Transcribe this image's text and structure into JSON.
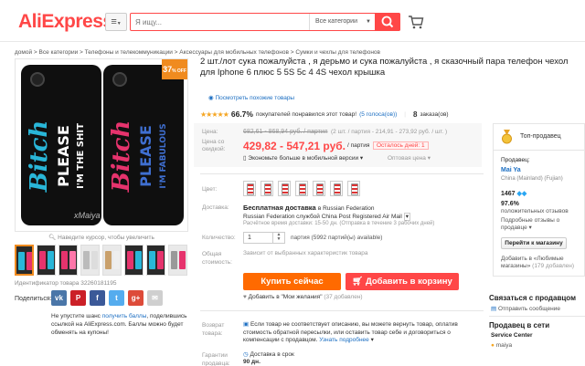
{
  "header": {
    "logo": "AliExpress",
    "search_placeholder": "Я ищу...",
    "category": "Все категории"
  },
  "breadcrumb": "домой > Все категории > Телефоны и телекоммуникации > Аксессуары для мобильных телефонов > Сумки и чехлы для телефонов",
  "gallery": {
    "discount": "37",
    "discount_suffix": "% OFF",
    "zoom_hint": "Наведите курсор, чтобы увеличить",
    "watermark": "xMaiya",
    "item_id": "Идентификатор товара 32260181195"
  },
  "share": {
    "label": "Поделиться:",
    "icons": [
      {
        "name": "vk-icon",
        "glyph": "vk",
        "color": "#4a76a8"
      },
      {
        "name": "pinterest-icon",
        "glyph": "P",
        "color": "#cb2027"
      },
      {
        "name": "facebook-icon",
        "glyph": "f",
        "color": "#3b5998"
      },
      {
        "name": "twitter-icon",
        "glyph": "t",
        "color": "#55acee"
      },
      {
        "name": "google-plus-icon",
        "glyph": "g+",
        "color": "#dd4b39"
      },
      {
        "name": "email-icon",
        "glyph": "✉",
        "color": "#cfcfcf"
      }
    ],
    "note_pre": "Не упустите шанс ",
    "note_link": "получить баллы",
    "note_post": ", поделившись ссылкой на AliExpress.com. Баллы можно будет обменять на купоны!"
  },
  "product": {
    "title": "2 шт./лот сука пожалуйста , я дерьмо и сука пожалуйста , я сказочный пара телефон чехол для Iphone 6 плюс 5 5S 5c 4 4S чехол крышка",
    "similar": "Посмотреть похожие товары",
    "stars": "★★★★★",
    "rating_pct": "66.7%",
    "rating_text": "покупателей понравился этот товар!",
    "votes": "(5 голоса(ов))",
    "orders": "8",
    "orders_label": "заказа(ов)"
  },
  "price": {
    "label": "Цена:",
    "old": "682,61 - 868,94 руб. / партия",
    "old_alt": "(2 шт. / партия - 214,91 - 273,92 руб. / шт. )",
    "discount_label": "Цена со скидкой:",
    "new": "429,82 - 547,21 руб.",
    "unit": "/ партия",
    "countdown": "Осталось дней: 1",
    "mobile": "Экономьте больше в мобильной версии",
    "wholesale": "Оптовая цена"
  },
  "options": {
    "color_label": "Цвет:",
    "delivery_label": "Доставка:",
    "delivery_free": "Бесплатная доставка",
    "delivery_to": "в Russian Federation",
    "delivery_method": "Russian Federation службой China Post Registered Air Mail",
    "delivery_time": "Расчётное время доставки: 15-50 дн. (Отправка в течение 3 рабочих дней)",
    "qty_label": "Количество:",
    "qty_value": "1",
    "qty_text": "партия (5992 партий(ы) available)",
    "total_label": "Общая стоимость:",
    "total_text": "Зависит от выбранных характеристик товара",
    "buy": "Купить сейчас",
    "add_cart": "Добавить в корзину",
    "wish": "Добавить в \"Мои желания\"",
    "wish_count": "(37 добавлен)"
  },
  "returns": {
    "label": "Возврат товара:",
    "text": "Если товар не соответствует описанию, вы можете вернуть товар, оплатив стоимость обратной пересылки, или оставить товар себе и договориться о компенсации с продавцом. ",
    "more": "Узнать подробнее",
    "guarantee_label": "Гарантии продавца:",
    "guarantee_text": "Доставка в срок",
    "guarantee_days": "90 дн."
  },
  "seller": {
    "badge": "Топ-продавец",
    "product_label": "Продавец:",
    "name": "Mai Ya",
    "location": "China (Mainland) (Fujian)",
    "score": "1467",
    "positive": "97.6%",
    "positive_label": "положительных отзывов",
    "details": "Подробные отзывы о продавце",
    "go_store": "Перейти к магазину",
    "wishlist": "Добавить в «Любимые магазины»",
    "wishlist_count": "(179 добавлен)",
    "contact_title": "Связаться с продавцом",
    "message": "Отправить сообщение",
    "network_title": "Продавец в сети",
    "service": "Service Center",
    "online_name": "maiya"
  }
}
